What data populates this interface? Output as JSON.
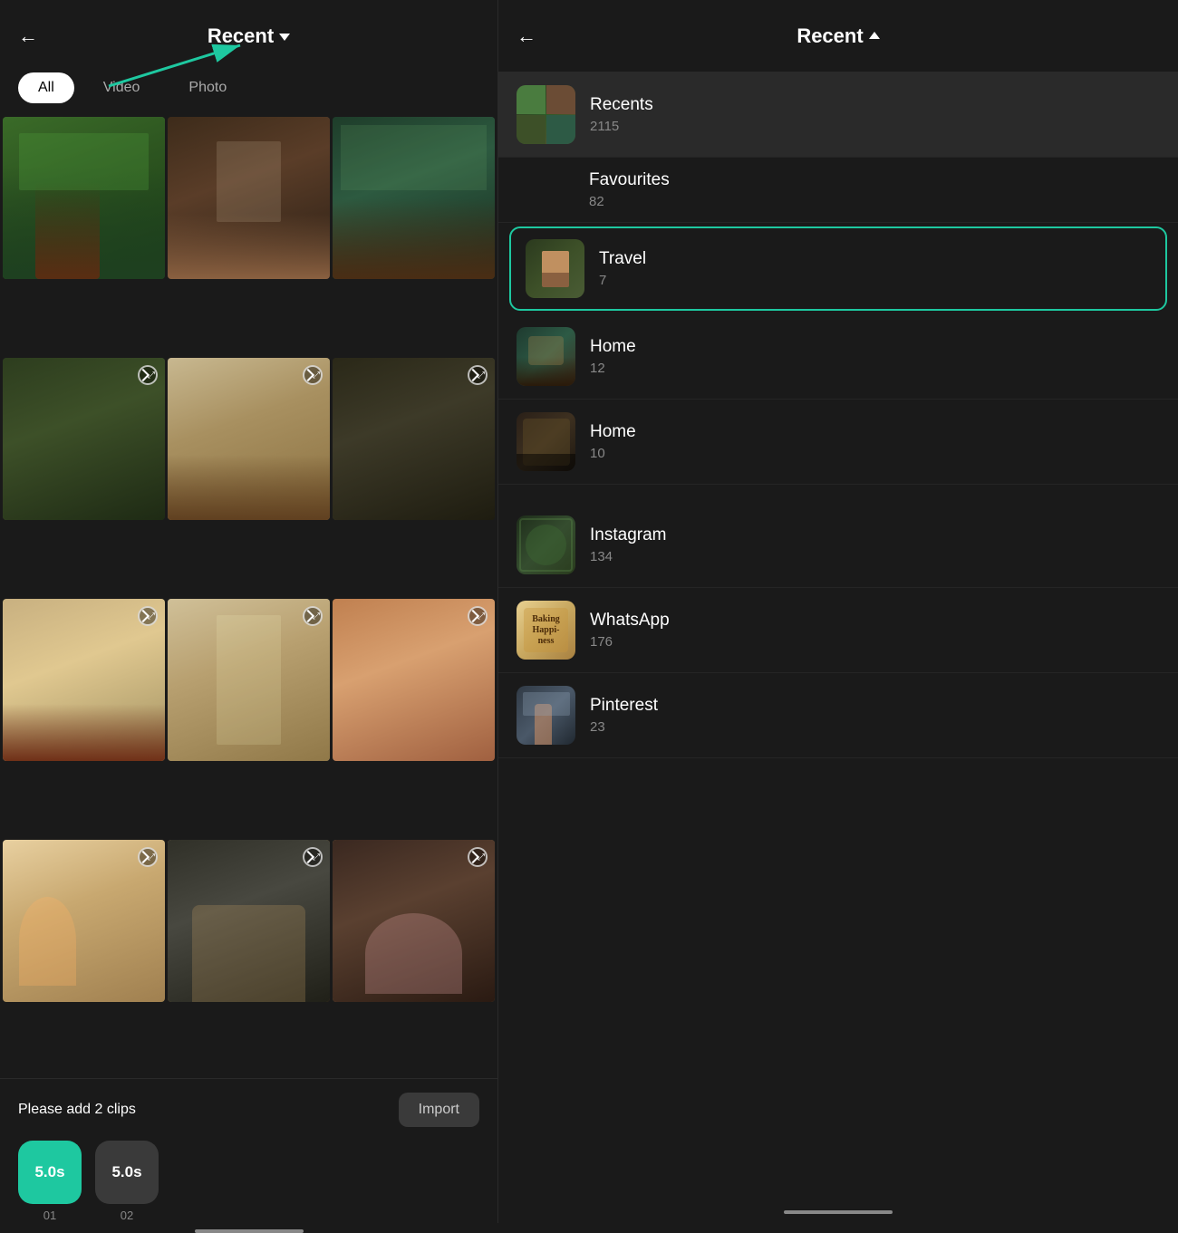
{
  "left": {
    "back_symbol": "←",
    "title": "Recent",
    "title_arrow": "▼",
    "filters": [
      {
        "label": "All",
        "active": true
      },
      {
        "label": "Video",
        "active": false
      },
      {
        "label": "Photo",
        "active": false
      }
    ],
    "photos": [
      {
        "id": 1,
        "class": "cell-1",
        "has_expand": false
      },
      {
        "id": 2,
        "class": "cell-2",
        "has_expand": false
      },
      {
        "id": 3,
        "class": "cell-3",
        "has_expand": false
      },
      {
        "id": 4,
        "class": "cell-4",
        "has_expand": true
      },
      {
        "id": 5,
        "class": "cell-5",
        "has_expand": true
      },
      {
        "id": 6,
        "class": "cell-6",
        "has_expand": true
      },
      {
        "id": 7,
        "class": "cell-7",
        "has_expand": true
      },
      {
        "id": 8,
        "class": "cell-8",
        "has_expand": true
      },
      {
        "id": 9,
        "class": "cell-9",
        "has_expand": true
      },
      {
        "id": 10,
        "class": "cell-10",
        "has_expand": true
      },
      {
        "id": 11,
        "class": "cell-11",
        "has_expand": true
      },
      {
        "id": 12,
        "class": "cell-12",
        "has_expand": true
      }
    ],
    "bottom": {
      "clips_label": "Please add 2 clips",
      "import_label": "Import",
      "clips": [
        {
          "label": "5.0s",
          "active": true,
          "number": "01"
        },
        {
          "label": "5.0s",
          "active": false,
          "number": "02"
        }
      ]
    }
  },
  "right": {
    "back_symbol": "←",
    "title": "Recent",
    "title_arrow": "▲",
    "albums": [
      {
        "name": "Recents",
        "count": "2115",
        "thumb_class": "thumb-recents",
        "selected": false,
        "first": true
      },
      {
        "name": "Favourites",
        "count": "82",
        "thumb_class": "",
        "selected": false,
        "first": false
      },
      {
        "name": "Travel",
        "count": "7",
        "thumb_class": "thumb-travel",
        "selected": true,
        "first": false
      },
      {
        "name": "Home",
        "count": "12",
        "thumb_class": "thumb-home1",
        "selected": false,
        "first": false
      },
      {
        "name": "Home",
        "count": "10",
        "thumb_class": "thumb-home2",
        "selected": false,
        "first": false
      },
      {
        "name": "Instagram",
        "count": "134",
        "thumb_class": "thumb-instagram",
        "selected": false,
        "first": false
      },
      {
        "name": "WhatsApp",
        "count": "176",
        "thumb_class": "thumb-whatsapp",
        "selected": false,
        "first": false
      },
      {
        "name": "Pinterest",
        "count": "23",
        "thumb_class": "thumb-pinterest",
        "selected": false,
        "first": false
      }
    ]
  }
}
